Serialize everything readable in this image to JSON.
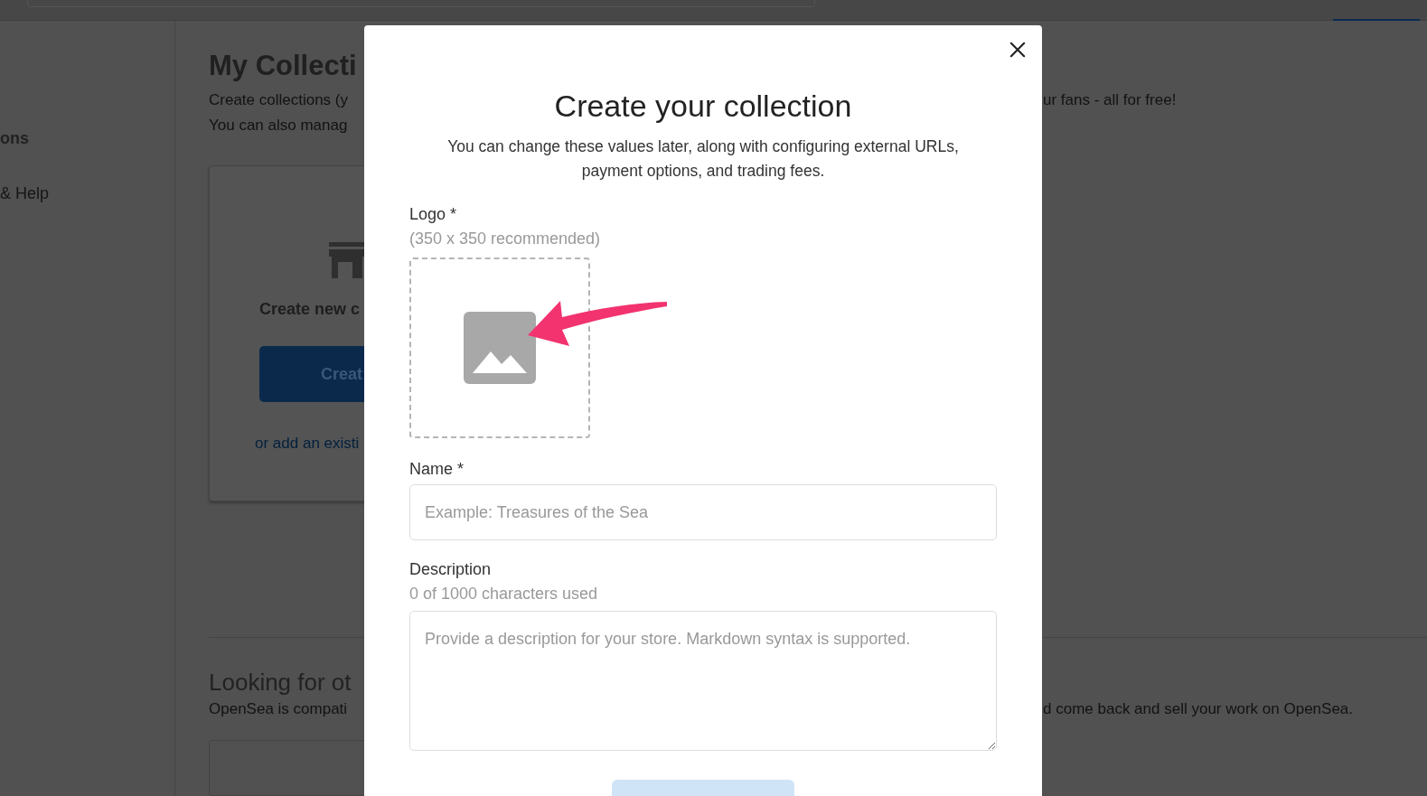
{
  "page": {
    "sidebar": {
      "items": [
        "ons",
        "& Help"
      ]
    },
    "header": {
      "title": "My Collecti",
      "intro": [
        "Create collections (y",
        "You can also manag"
      ],
      "intro_right": "ur fans - all for free!"
    },
    "card": {
      "title": "Create new c",
      "button": "Creat",
      "link": "or add an existi"
    },
    "section": {
      "title": "Looking for ot",
      "text": "OpenSea is compati",
      "text_right": "d come back and sell your work on OpenSea."
    }
  },
  "modal": {
    "title": "Create your collection",
    "subtitle": "You can change these values later, along with configuring external URLs, payment options, and trading fees.",
    "logo": {
      "label": "Logo *",
      "hint": "(350 x 350 recommended)"
    },
    "name": {
      "label": "Name *",
      "placeholder": "Example: Treasures of the Sea"
    },
    "description": {
      "label": "Description",
      "hint": "0 of 1000 characters used",
      "placeholder": "Provide a description for your store. Markdown syntax is supported."
    }
  }
}
